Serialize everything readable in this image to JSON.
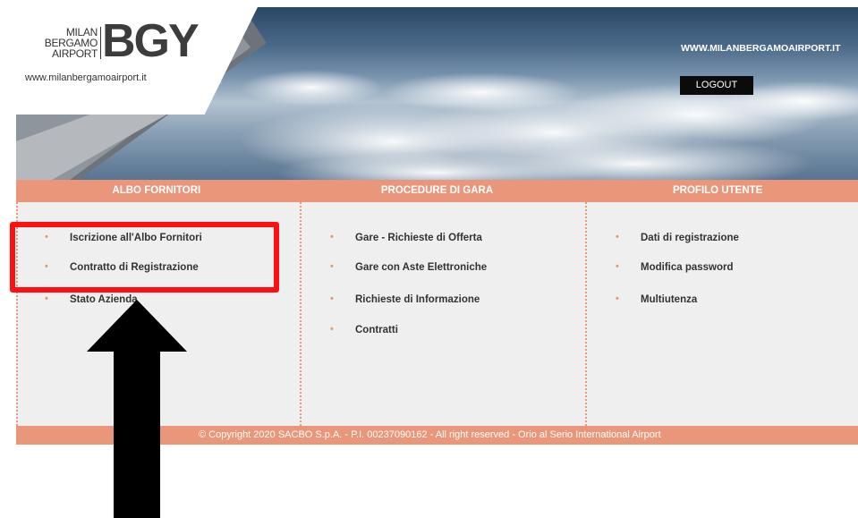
{
  "header": {
    "logo": {
      "small_lines": [
        "MILAN",
        "BERGAMO",
        "AIRPORT"
      ],
      "mark": "BGY",
      "url": "www.milanbergamoairport.it"
    },
    "site_link": "WWW.MILANBERGAMOAIRPORT.IT",
    "logout_label": "LOGOUT"
  },
  "tabs": [
    {
      "label": "ALBO FORNITORI"
    },
    {
      "label": "PROCEDURE DI GARA"
    },
    {
      "label": "PROFILO UTENTE"
    }
  ],
  "columns": [
    {
      "items": [
        "Iscrizione all'Albo Fornitori",
        "Contratto di Registrazione",
        "Stato Azienda"
      ]
    },
    {
      "items": [
        "Gare - Richieste di Offerta",
        "Gare con Aste Elettroniche",
        "Richieste di Informazione",
        "Contratti"
      ]
    },
    {
      "items": [
        "Dati di registrazione",
        "Modifica password",
        "Multiutenza"
      ]
    }
  ],
  "bullet": "•",
  "footer": {
    "text": "© Copyright 2020 SACBO S.p.A. - P.I. 00237090162 - All right reserved - Orio al Serio International Airport"
  },
  "colors": {
    "accent": "#e9967a",
    "highlight_box": "#ff1010",
    "arrow": "#000000",
    "content_bg": "#efefef"
  }
}
